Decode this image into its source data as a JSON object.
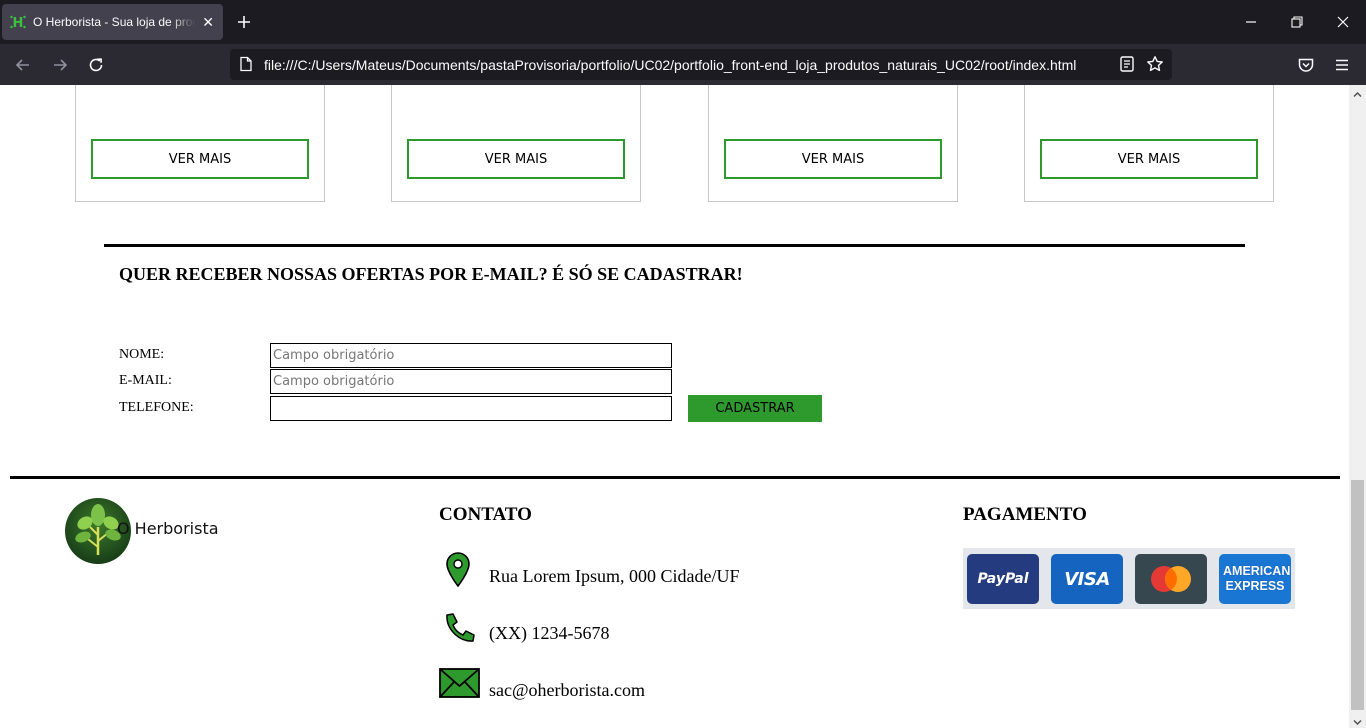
{
  "browser": {
    "tab_title": "O Herborista - Sua loja de produtos naturais",
    "url": "file:///C:/Users/Mateus/Documents/pastaProvisoria/portfolio/UC02/portfolio_front-end_loja_produtos_naturais_UC02/root/index.html"
  },
  "products": {
    "cards": [
      {
        "button": "VER MAIS"
      },
      {
        "button": "VER MAIS"
      },
      {
        "button": "VER MAIS"
      },
      {
        "button": "VER MAIS"
      }
    ]
  },
  "newsletter": {
    "title": "QUER RECEBER NOSSAS OFERTAS POR E-MAIL? É SÓ SE CADASTRAR!",
    "fields": [
      {
        "label": "NOME:",
        "value": "",
        "placeholder": "Campo obrigatório"
      },
      {
        "label": "E-MAIL:",
        "value": "",
        "placeholder": "Campo obrigatório"
      },
      {
        "label": "TELEFONE:",
        "value": "",
        "placeholder": ""
      }
    ],
    "submit_label": "CADASTRAR",
    "accent_color": "#2e9a2e"
  },
  "footer": {
    "logo_text": "O Herborista",
    "contact": {
      "heading": "CONTATO",
      "address": "Rua Lorem Ipsum, 000 Cidade/UF",
      "phone": "(XX) 1234-5678",
      "email": "sac@oherborista.com"
    },
    "payment": {
      "heading": "PAGAMENTO",
      "methods": [
        "PayPal",
        "VISA",
        "Mastercard",
        "AMERICAN EXPRESS"
      ]
    }
  }
}
